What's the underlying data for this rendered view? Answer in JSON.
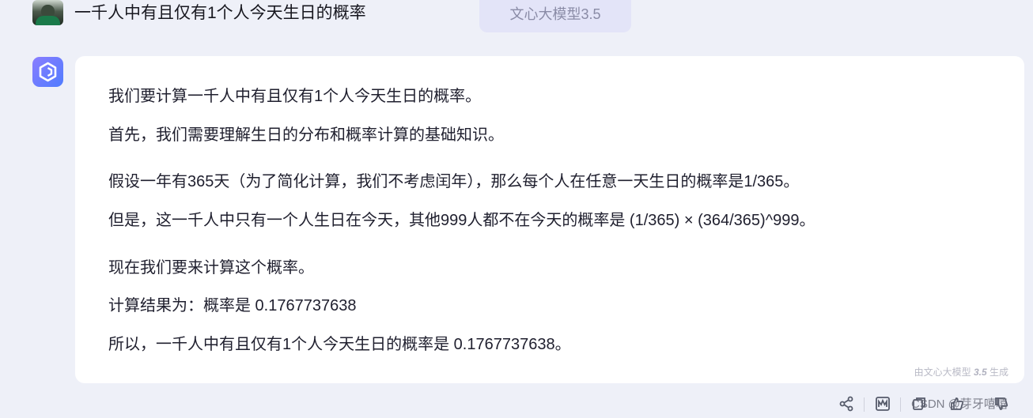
{
  "question": {
    "text": "一千人中有且仅有1个人今天生日的概率"
  },
  "model_badge": "文心大模型3.5",
  "answer": {
    "lines": [
      "我们要计算一千人中有且仅有1个人今天生日的概率。",
      "首先，我们需要理解生日的分布和概率计算的基础知识。",
      "假设一年有365天（为了简化计算，我们不考虑闰年），那么每个人在任意一天生日的概率是1/365。",
      "但是，这一千人中只有一个人生日在今天，其他999人都不在今天的概率是 (1/365) × (364/365)^999。",
      "现在我们要来计算这个概率。",
      "计算结果为：概率是 0.1767737638",
      "所以，一千人中有且仅有1个人今天生日的概率是 0.1767737638。"
    ],
    "footer_prefix": "由文心大模型",
    "footer_version": "3.5",
    "footer_suffix": "生成"
  },
  "toolbar": {
    "icons": [
      "share-icon",
      "mind-map-icon",
      "copy-icon",
      "thumbs-up-icon",
      "thumbs-down-icon"
    ]
  },
  "watermark": "CSDN @芽牙嘻嘻",
  "colors": {
    "page_background": "#eef0f8",
    "card_background": "#ffffff",
    "badge_background": "#e3e4f8",
    "avatar_gradient_start": "#8a7dff",
    "avatar_gradient_end": "#4f7cff"
  }
}
